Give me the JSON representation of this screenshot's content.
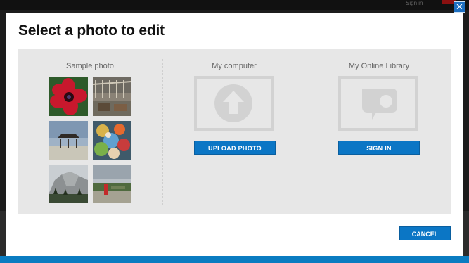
{
  "topbar": {
    "signin_text": "Sign in"
  },
  "dialog": {
    "title": "Select a photo to edit",
    "close_icon": "close-icon"
  },
  "columns": {
    "sample": {
      "label": "Sample photo",
      "photos": [
        "flower",
        "porch",
        "gazebo",
        "parade",
        "mountain",
        "roadside"
      ]
    },
    "computer": {
      "label": "My computer",
      "icon": "upload-arrow-icon",
      "button": "UPLOAD PHOTO"
    },
    "library": {
      "label": "My Online Library",
      "icon": "speech-bubble-icon",
      "button": "SIGN IN"
    }
  },
  "footer": {
    "cancel": "CANCEL"
  },
  "colors": {
    "accent": "#0b76c5",
    "panel": "#e7e7e7",
    "placeholder": "#d2d2d2"
  }
}
